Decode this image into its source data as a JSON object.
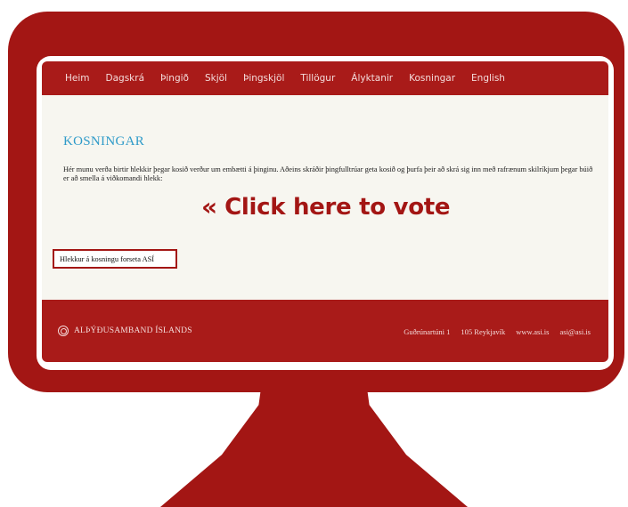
{
  "nav": {
    "items": [
      "Heim",
      "Dagskrá",
      "Þingið",
      "Skjöl",
      "Þingskjöl",
      "Tillögur",
      "Ályktanir",
      "Kosningar",
      "English"
    ]
  },
  "main": {
    "title": "KOSNINGAR",
    "intro": "Hér munu verða birtir hlekkir þegar kosið verður um embætti á þinginu. Aðeins skráðir þingfulltrúar geta kosið og þurfa þeir að skrá sig inn með rafrænum skilríkjum þegar búið er að smella á viðkomandi hlekk:",
    "vote_link": "Hlekkur á kosningu forseta ASÍ"
  },
  "footer": {
    "org": "ALÞÝÐUSAMBAND ÍSLANDS",
    "address": "Guðrúnartúni 1",
    "city": "105 Reykjavík",
    "website": "www.asi.is",
    "email": "asi@asi.is"
  },
  "callout": {
    "chevron": "«",
    "text": "Click here to vote"
  },
  "colors": {
    "brand_red": "#a31614",
    "title_blue": "#2f9bc9",
    "page_bg": "#f7f6f0"
  }
}
